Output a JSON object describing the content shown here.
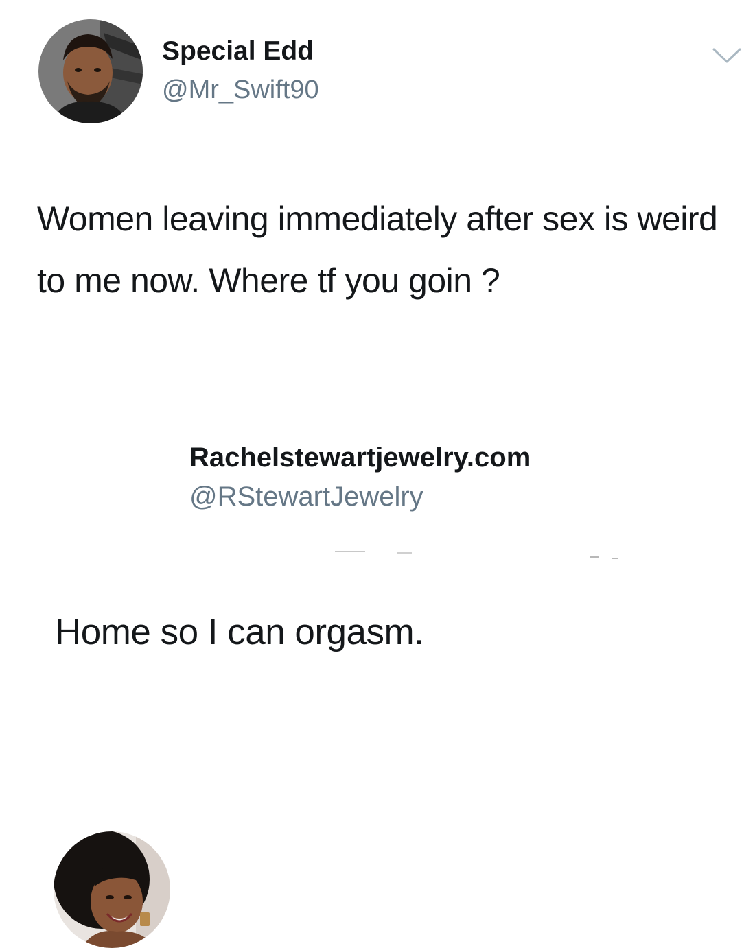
{
  "tweets": [
    {
      "display_name": "Special Edd",
      "handle": "@Mr_Swift90",
      "text": "Women leaving immediately after sex is weird to me now. Where tf you goin ?",
      "menu_icon": "chevron-down-icon"
    },
    {
      "display_name": "Rachelstewartjewelry.com",
      "handle": "@RStewartJewelry",
      "text": "Home so I can orgasm."
    }
  ],
  "colors": {
    "text_primary": "#14171a",
    "text_secondary": "#657786",
    "background": "#ffffff",
    "chevron": "#aab8c2"
  }
}
